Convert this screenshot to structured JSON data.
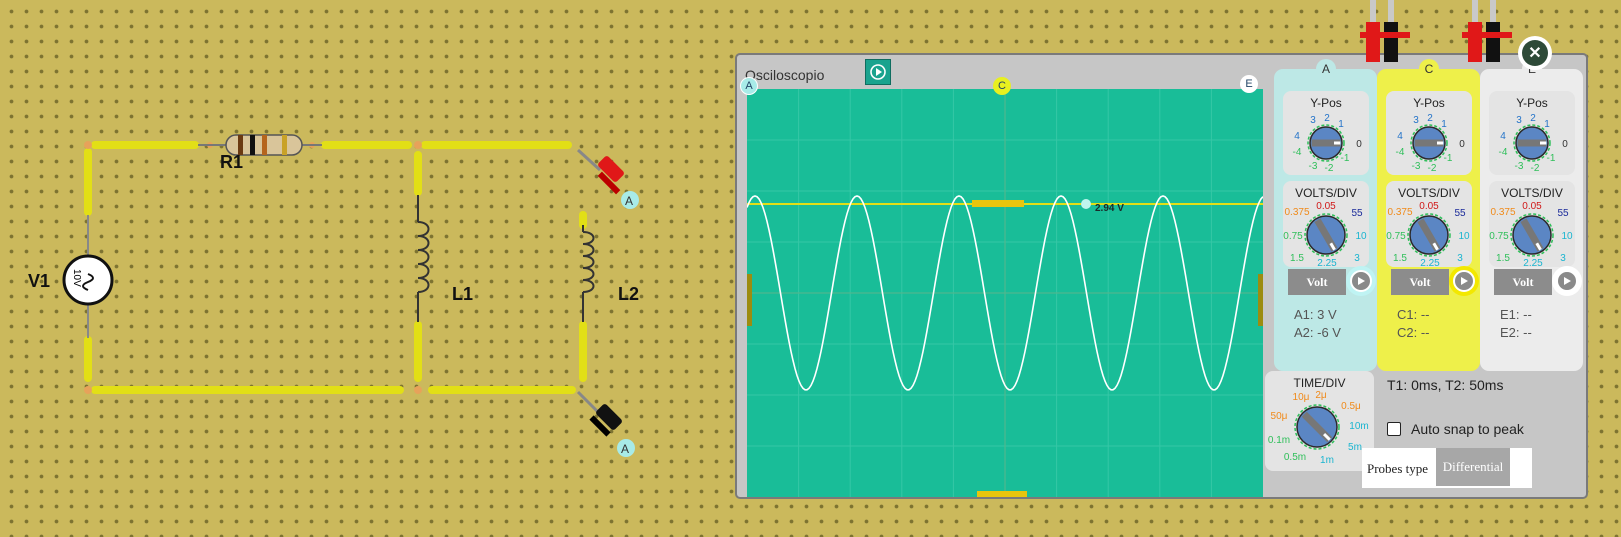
{
  "circuit": {
    "components": {
      "r1": "R1",
      "v1": "V1",
      "v1_value": "10V",
      "l1": "L1",
      "l2": "L2"
    },
    "probe_labels": {
      "probe_top": "A",
      "probe_bottom": "A"
    }
  },
  "oscilloscope": {
    "title": "Osciloscopio",
    "screen_markers": {
      "left": "A",
      "top": "C",
      "right": "E"
    },
    "cursor_readout": "2.94 V",
    "channels": [
      {
        "letter": "A",
        "ypos_title": "Y-Pos",
        "ypos_scale": [
          "3",
          "2",
          "1",
          "4",
          "0",
          "-4",
          "-1",
          "-3",
          "-2"
        ],
        "volts_title": "VOLTS/DIV",
        "volts_scale": [
          "0.375",
          "0.05",
          "55",
          "0.75",
          "10",
          "1.5",
          "3",
          "2.25"
        ],
        "unit_button": "Volt",
        "readout1": "A1: 3 V",
        "readout2": "A2: -6 V",
        "color": "#bde8e6"
      },
      {
        "letter": "C",
        "ypos_title": "Y-Pos",
        "ypos_scale": [
          "3",
          "2",
          "1",
          "4",
          "0",
          "-4",
          "-1",
          "-3",
          "-2"
        ],
        "volts_title": "VOLTS/DIV",
        "volts_scale": [
          "0.375",
          "0.05",
          "55",
          "0.75",
          "10",
          "1.5",
          "3",
          "2.25"
        ],
        "unit_button": "Volt",
        "readout1": "C1: --",
        "readout2": "C2: --",
        "color": "#eef04a"
      },
      {
        "letter": "E",
        "ypos_title": "Y-Pos",
        "ypos_scale": [
          "3",
          "2",
          "1",
          "4",
          "0",
          "-4",
          "-1",
          "-3",
          "-2"
        ],
        "volts_title": "VOLTS/DIV",
        "volts_scale": [
          "0.375",
          "0.05",
          "55",
          "0.75",
          "10",
          "1.5",
          "3",
          "2.25"
        ],
        "unit_button": "Volt",
        "readout1": "E1: --",
        "readout2": "E2: --",
        "color": "#ececec"
      }
    ],
    "time_div": {
      "title": "TIME/DIV",
      "scale": [
        "10μ",
        "2μ",
        "0.5μ",
        "50μ",
        "10m",
        "0.1m",
        "5m",
        "0.5m",
        "1m"
      ]
    },
    "time_readout": "T1: 0ms, T2: 50ms",
    "auto_snap": {
      "label": "Auto snap to peak",
      "checked": false
    },
    "probes_type": {
      "label": "Probes type",
      "value": "Differential"
    }
  }
}
